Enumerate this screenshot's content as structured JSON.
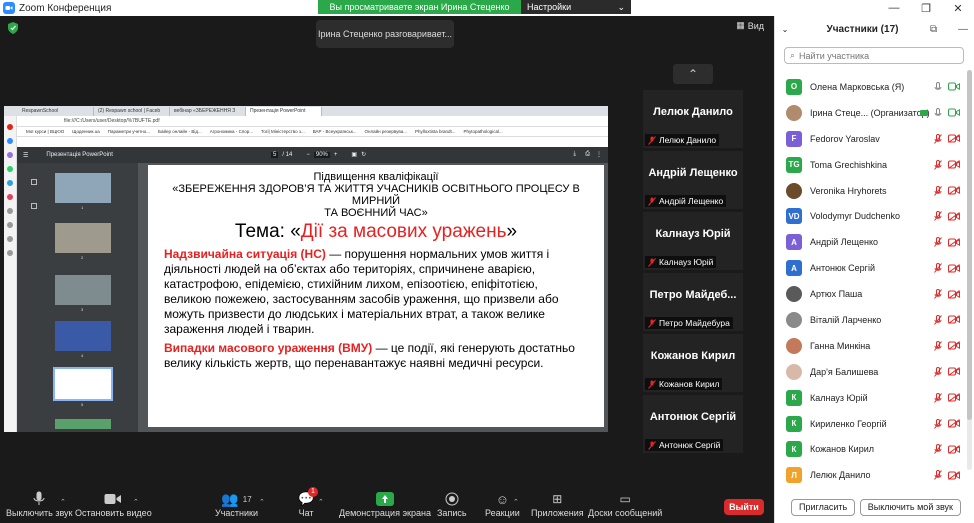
{
  "window": {
    "title": "Zoom Конференция"
  },
  "share_bar": {
    "status": "Вы просматриваете экран Ирина Стеценко",
    "options": "Настройки просмотра"
  },
  "talking_indicator": "Ірина Стеценко разговаривает...",
  "view_button": "Вид",
  "browser": {
    "tabs": [
      "RespawnSchool",
      "(2) Respawn school | Faceb",
      "вебінар «ЗБЕРЕЖЕННЯ З",
      "Презентація PowerPoint"
    ],
    "address": "file:///C:/Users/user/Desktop/%7BUFTE.pdf",
    "bookmarks": [
      "Мої курси | ВЦЮО",
      "Щоденник.ua",
      "Параметри учетно...",
      "Байер онлайн - Від...",
      "Агрономика - Спор...",
      "Тогі| Міністерство з...",
      "ВАР - Всеукраїнськ...",
      "Онлайн резервува...",
      "Phylloxtista brandt...",
      "Phytopathological..."
    ]
  },
  "pdf_viewer": {
    "doc_name": "Презентація PowerPoint",
    "page_current": "5",
    "page_total": "/ 14",
    "zoom": "90%",
    "thumb_numbers": [
      "1",
      "2",
      "3",
      "4",
      "5"
    ]
  },
  "slide": {
    "subtitle": "Підвищення кваліфікації",
    "heading_line1": "«ЗБЕРЕЖЕННЯ ЗДОРОВ’Я ТА ЖИТТЯ УЧАСНИКІВ ОСВІТНЬОГО ПРОЦЕСУ В МИРНИЙ",
    "heading_line2": "ТА ВОЄННИЙ ЧАС»",
    "theme_prefix": "Тема: «",
    "theme_topic": "Дії за масових уражень",
    "theme_suffix": "»",
    "p1_term": "Надзвичайна ситуація (НС)",
    "p1_text": " — порушення нормальних умов життя і діяльності людей на об’єктах або територіях, спричинене аварією, катастрофою, епідемією, стихійним лихом, епізоотією, епіфітотією, великою пожежею, застосуванням засобів ураження, що призвели або можуть призвести до людських і матеріальних втрат, а також велике зараження людей і тварин.",
    "p2_term": "Випадки масового ураження (ВМУ)",
    "p2_text": " — це події, які генерують достатньо велику кількість жертв, що перенавантажує наявні медичні ресурси."
  },
  "video_tiles": [
    {
      "big": "Лелюк Данило",
      "small": "Лелюк Данило"
    },
    {
      "big": "Андрій Лещенко",
      "small": "Андрій Лещенко"
    },
    {
      "big": "Калнауз Юрій",
      "small": "Калнауз Юрій"
    },
    {
      "big": "Петро  Майдеб...",
      "small": "Петро Майдебура"
    },
    {
      "big": "Кожанов Кирил",
      "small": "Кожанов Кирил"
    },
    {
      "big": "Антонюк Сергій",
      "small": "Антонюк Сергій"
    }
  ],
  "toolbar": {
    "mute": "Выключить звук",
    "video": "Остановить видео",
    "participants": "Участники",
    "participants_count": "17",
    "chat": "Чат",
    "chat_badge": "1",
    "share": "Демонстрация экрана",
    "record": "Запись",
    "reactions": "Реакции",
    "apps": "Приложения",
    "whiteboard": "Доски сообщений",
    "leave": "Выйти"
  },
  "participants_panel": {
    "title": "Участники (17)",
    "search_placeholder": "Найти участника",
    "invite": "Пригласить",
    "mute_me": "Выключить мой звук",
    "participants": [
      {
        "name": "Олена Марковська (Я)",
        "initials": "О",
        "color": "#2aa84a",
        "photo": false
      },
      {
        "name": "Ірина Стеце... (Организатор)",
        "initials": "",
        "color": "#b08b6e",
        "photo": true
      },
      {
        "name": "Fedorov Yaroslav",
        "initials": "F",
        "color": "#7b5fd6",
        "photo": false
      },
      {
        "name": "Toma Grechishkina",
        "initials": "TG",
        "color": "#2aa84a",
        "photo": false
      },
      {
        "name": "Veronika Hryhorets",
        "initials": "",
        "color": "#6b4b2a",
        "photo": true
      },
      {
        "name": "Volodymyr Dudchenko",
        "initials": "VD",
        "color": "#2f6fd0",
        "photo": false
      },
      {
        "name": "Андрій Лещенко",
        "initials": "А",
        "color": "#7b5fd6",
        "photo": false
      },
      {
        "name": "Антонюк Сергій",
        "initials": "А",
        "color": "#2f6fd0",
        "photo": false
      },
      {
        "name": "Артюх Паша",
        "initials": "",
        "color": "#5a5a5a",
        "photo": true
      },
      {
        "name": "Віталій Ларченко",
        "initials": "",
        "color": "#8a8a8a",
        "photo": true
      },
      {
        "name": "Ганна Минкіна",
        "initials": "",
        "color": "#c47a5a",
        "photo": true
      },
      {
        "name": "Дар'я Балишева",
        "initials": "",
        "color": "#d8b9a8",
        "photo": true
      },
      {
        "name": "Калнауз Юрій",
        "initials": "К",
        "color": "#2aa84a",
        "photo": false
      },
      {
        "name": "Кириленко Георгій",
        "initials": "К",
        "color": "#2aa84a",
        "photo": false
      },
      {
        "name": "Кожанов Кирил",
        "initials": "К",
        "color": "#2aa84a",
        "photo": false
      },
      {
        "name": "Лелюк Данило",
        "initials": "Л",
        "color": "#f0a22a",
        "photo": false
      }
    ]
  }
}
